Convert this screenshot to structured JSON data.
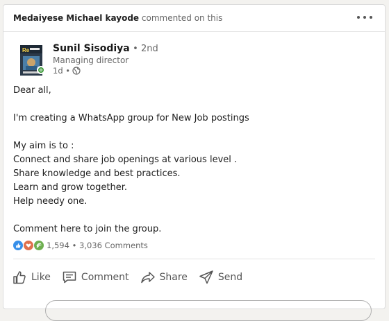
{
  "activity": {
    "actor": "Medaiyese Michael kayode",
    "action_text": "commented on this",
    "more_icon": "ellipsis-horizontal-icon"
  },
  "author": {
    "name": "Sunil Sisodiya",
    "degree": "• 2nd",
    "headline": "Managing director",
    "time": "1d •",
    "visibility_icon": "globe-icon",
    "online_status": "online",
    "avatar_icon": "profile-avatar-book-cover"
  },
  "post": {
    "lines": [
      "Dear all,",
      "",
      "I'm creating a WhatsApp group for New Job postings",
      "",
      "My aim is to :",
      "Connect and share job openings at various level .",
      "Share knowledge and best practices.",
      "Learn and grow together.",
      "Help needy one.",
      "",
      "Comment here to join the group."
    ]
  },
  "social": {
    "reaction_icons": [
      "like-icon",
      "love-icon",
      "support-icon"
    ],
    "counts_text": "1,594 • 3,036 Comments"
  },
  "actions": {
    "like": "Like",
    "comment": "Comment",
    "share": "Share",
    "send": "Send"
  },
  "colors": {
    "text_primary": "#191919",
    "text_secondary": "#666666",
    "like_blue": "#378fe9",
    "love_red": "#df704d",
    "support_green": "#6dae4f",
    "online_green": "#3e9a3a"
  }
}
